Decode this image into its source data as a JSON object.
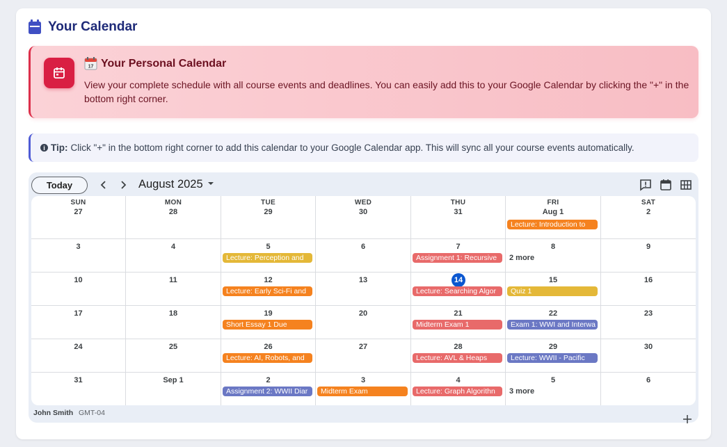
{
  "page": {
    "title": "Your Calendar"
  },
  "banner": {
    "title": "Your Personal Calendar",
    "text": "View your complete schedule with all course events and deadlines. You can easily add this to your Google Calendar by clicking the \"+\" in the bottom right corner."
  },
  "tip": {
    "label": "Tip:",
    "text": "Click \"+\" in the bottom right corner to add this calendar to your Google Calendar app. This will sync all your course events automatically."
  },
  "calendar": {
    "today_label": "Today",
    "month_label": "August 2025",
    "weekdays": [
      "SUN",
      "MON",
      "TUE",
      "WED",
      "THU",
      "FRI",
      "SAT"
    ],
    "weeks": [
      [
        "27",
        "28",
        "29",
        "30",
        "31",
        "Aug 1",
        "2"
      ],
      [
        "3",
        "4",
        "5",
        "6",
        "7",
        "8",
        "9"
      ],
      [
        "10",
        "11",
        "12",
        "13",
        "14",
        "15",
        "16"
      ],
      [
        "17",
        "18",
        "19",
        "20",
        "21",
        "22",
        "23"
      ],
      [
        "24",
        "25",
        "26",
        "27",
        "28",
        "29",
        "30"
      ],
      [
        "31",
        "Sep 1",
        "2",
        "3",
        "4",
        "5",
        "6"
      ]
    ],
    "today": {
      "week": 2,
      "day": 4
    },
    "events": [
      {
        "week": 0,
        "day": 5,
        "title": "Lecture: Introduction to",
        "color": "#f5821f"
      },
      {
        "week": 1,
        "day": 2,
        "title": "Lecture: Perception and",
        "color": "#e4b838"
      },
      {
        "week": 1,
        "day": 4,
        "title": "Assignment 1: Recursive",
        "color": "#e86a6a"
      },
      {
        "week": 2,
        "day": 2,
        "title": "Lecture: Early Sci-Fi and",
        "color": "#f5821f"
      },
      {
        "week": 2,
        "day": 4,
        "title": "Lecture: Searching Algor",
        "color": "#e86a6a"
      },
      {
        "week": 2,
        "day": 5,
        "title": "Quiz 1",
        "color": "#e4b838"
      },
      {
        "week": 3,
        "day": 2,
        "title": "Short Essay 1 Due",
        "color": "#f5821f"
      },
      {
        "week": 3,
        "day": 4,
        "title": "Midterm Exam 1",
        "color": "#e86a6a"
      },
      {
        "week": 3,
        "day": 5,
        "title": "Exam 1: WWI and Interwa",
        "color": "#6b78c4"
      },
      {
        "week": 4,
        "day": 2,
        "title": "Lecture: AI, Robots, and",
        "color": "#f5821f"
      },
      {
        "week": 4,
        "day": 4,
        "title": "Lecture: AVL & Heaps",
        "color": "#e86a6a"
      },
      {
        "week": 4,
        "day": 5,
        "title": "Lecture: WWII - Pacific",
        "color": "#6b78c4"
      },
      {
        "week": 5,
        "day": 2,
        "title": "Assignment 2: WWII Diar",
        "color": "#6b78c4"
      },
      {
        "week": 5,
        "day": 3,
        "title": "Midterm Exam",
        "color": "#f5821f"
      },
      {
        "week": 5,
        "day": 4,
        "title": "Lecture: Graph Algorithn",
        "color": "#e86a6a"
      }
    ],
    "more": [
      {
        "week": 1,
        "day": 5,
        "label": "2 more"
      },
      {
        "week": 5,
        "day": 5,
        "label": "3 more"
      }
    ],
    "footer": {
      "user": "John Smith",
      "timezone": "GMT-04"
    }
  },
  "colors": {
    "title": "#1e2a78",
    "banner_accent": "#dc2f4a",
    "tip_accent": "#4f5bd5",
    "today_circle": "#0b57d0"
  },
  "icons": {
    "title": "calendar-icon",
    "banner": "calendar-icon",
    "tip": "info-icon",
    "toolbar": [
      "feedback-icon",
      "calendar-view-icon",
      "grid-view-icon"
    ],
    "add": "plus-icon"
  }
}
